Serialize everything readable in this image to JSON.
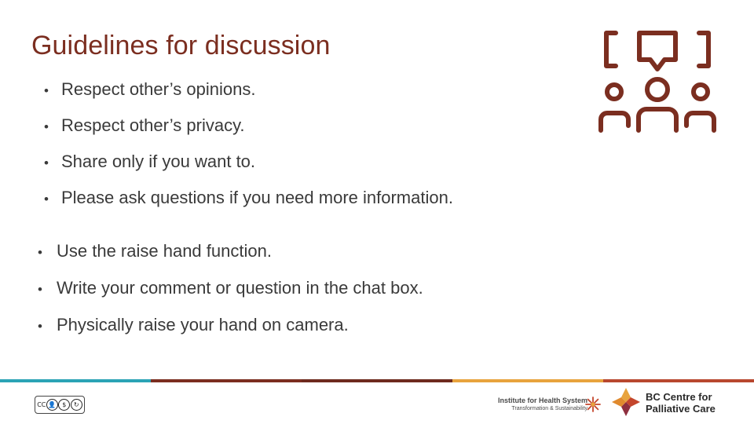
{
  "slide": {
    "title": "Guidelines for discussion",
    "bullet_glyph": "•",
    "list_one": [
      "Respect other’s opinions.",
      "Respect other’s privacy.",
      "Share only if you want to.",
      "Please ask questions if you need more information."
    ],
    "list_two": [
      "Use the raise hand function.",
      "Write your comment or question in the chat box.",
      "Physically raise your hand on camera."
    ]
  },
  "icons": {
    "conversation": "conversation-people-icon",
    "cc_license": "creative-commons-badge",
    "ihst_star": "ihst-starburst-icon",
    "bccpc_star": "bc-centre-palliative-care-star-logo"
  },
  "footer": {
    "cc_label": "CC",
    "cc_marks": [
      "BY",
      "NC",
      "SA"
    ],
    "institute_line1": "Institute for Health System",
    "institute_line2": "Transformation & Sustainability",
    "bccpc_line1": "BC Centre for",
    "bccpc_line2": "Palliative Care"
  },
  "colors": {
    "title": "#7B2E20",
    "body_text": "#3A3A3A",
    "bar_teal": "#2BA3B5",
    "bar_dark_red": "#7B2E20",
    "bar_brown": "#6E2A1E",
    "bar_gold": "#E8A33D",
    "bar_orange_red": "#B8472F",
    "icon": "#7B2E20"
  }
}
